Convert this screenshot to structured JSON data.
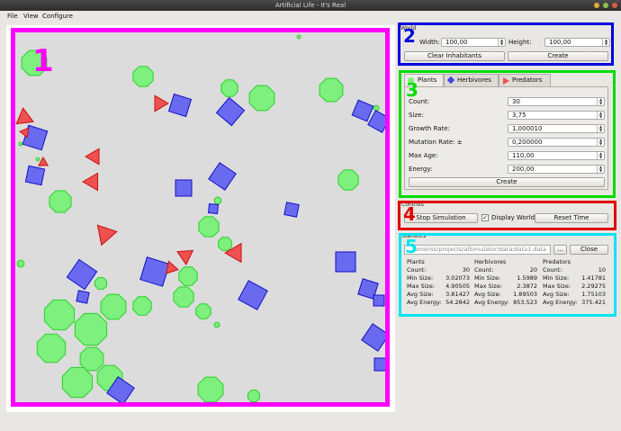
{
  "window": {
    "title": "Artificial Life - It's Real"
  },
  "menu": [
    {
      "label": "File"
    },
    {
      "label": "View"
    },
    {
      "label": "Configure"
    }
  ],
  "annotations": [
    "1",
    "2",
    "3",
    "4",
    "5"
  ],
  "world_group": {
    "title": "World",
    "width_label": "Width:",
    "width_value": "100,00",
    "height_label": "Height:",
    "height_value": "100,00",
    "clear_button": "Clear Inhabitants",
    "create_button": "Create"
  },
  "tabs": [
    {
      "label": "Plants"
    },
    {
      "label": "Herbivores"
    },
    {
      "label": "Predators"
    }
  ],
  "plants_form": {
    "fields": [
      {
        "label": "Count:",
        "value": "30"
      },
      {
        "label": "Size:",
        "value": "3,75"
      },
      {
        "label": "Growth Rate:",
        "value": "1,000010"
      },
      {
        "label": "Mutation Rate: ±",
        "value": "0,200000"
      },
      {
        "label": "Max Age:",
        "value": "110,00"
      },
      {
        "label": "Energy:",
        "value": "200,00"
      }
    ],
    "create_button": "Create"
  },
  "controls": {
    "title": "Controls",
    "stop_button": "Stop Simulation",
    "display_world_label": "Display World",
    "display_world_checked": true,
    "reset_button": "Reset Time"
  },
  "statistics": {
    "title": "Statistics",
    "file_path": "…uments/projects/alSimulator/data/data1.data",
    "browse_button": "...",
    "close_button": "Close",
    "groups": [
      {
        "name": "Plants",
        "rows": [
          {
            "k": "Count:",
            "v": "30"
          },
          {
            "k": "Min Size:",
            "v": "3.02073"
          },
          {
            "k": "Max Size:",
            "v": "4.90505"
          },
          {
            "k": "Avg Size:",
            "v": "3.81427"
          },
          {
            "k": "Avg Energy:",
            "v": "54.2842"
          }
        ]
      },
      {
        "name": "Herbivores",
        "rows": [
          {
            "k": "Count:",
            "v": "20"
          },
          {
            "k": "Min Size:",
            "v": "1.5989"
          },
          {
            "k": "Max Size:",
            "v": "2.3872"
          },
          {
            "k": "Avg Size:",
            "v": "1.89503"
          },
          {
            "k": "Avg Energy:",
            "v": "853.523"
          }
        ]
      },
      {
        "name": "Predators",
        "rows": [
          {
            "k": "Count:",
            "v": "10"
          },
          {
            "k": "Min Size:",
            "v": "1.41781"
          },
          {
            "k": "Max Size:",
            "v": "2.29275"
          },
          {
            "k": "Avg Size:",
            "v": "1.75103"
          },
          {
            "k": "Avg Energy:",
            "v": "375.421"
          }
        ]
      }
    ]
  },
  "colors": {
    "plant_fill": "#7df07d",
    "plant_stroke": "#2ad12a",
    "herbivore_fill": "#6a6af0",
    "herbivore_stroke": "#1010c8",
    "predator_fill": "#f05050",
    "predator_stroke": "#c81010",
    "hl1": "#ff00ff",
    "hl2": "#0000dd",
    "hl3": "#00dd00",
    "hl4": "#dd0000",
    "hl5": "#00e5ee"
  }
}
